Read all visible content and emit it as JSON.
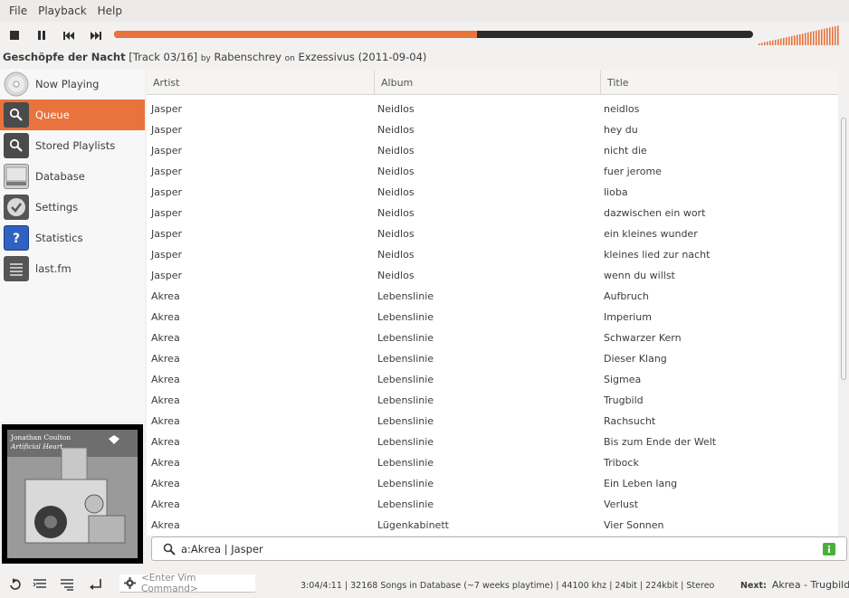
{
  "menubar": {
    "items": [
      "File",
      "Playback",
      "Help"
    ]
  },
  "toolbar": {
    "stop_icon": "stop-icon",
    "pause_icon": "pause-icon",
    "prev_icon": "previous-icon",
    "next_icon": "next-icon",
    "progress_fraction": 0.568,
    "accent": "#e8733c"
  },
  "now_playing": {
    "title": "Geschöpfe der Nacht",
    "track": "[Track 03/16]",
    "by": "by",
    "artist": "Rabenschrey",
    "on": "on",
    "album": "Exzessivus (2011-09-04)"
  },
  "sidebar": {
    "items": [
      {
        "label": "Now Playing",
        "icon": "cd-icon"
      },
      {
        "label": "Queue",
        "icon": "search-icon",
        "active": true
      },
      {
        "label": "Stored Playlists",
        "icon": "search-icon"
      },
      {
        "label": "Database",
        "icon": "drive-icon"
      },
      {
        "label": "Settings",
        "icon": "check-icon"
      },
      {
        "label": "Statistics",
        "icon": "help-icon"
      },
      {
        "label": "last.fm",
        "icon": "list-icon"
      }
    ]
  },
  "album_art": {
    "line1": "Jonathan Coulton",
    "line2": "Artificial Heart"
  },
  "table": {
    "headers": [
      "Artist",
      "Album",
      "Title"
    ],
    "rows": [
      [
        "Jasper",
        "Neidlos",
        "neidlos"
      ],
      [
        "Jasper",
        "Neidlos",
        "hey du"
      ],
      [
        "Jasper",
        "Neidlos",
        "nicht die"
      ],
      [
        "Jasper",
        "Neidlos",
        "fuer jerome"
      ],
      [
        "Jasper",
        "Neidlos",
        "lioba"
      ],
      [
        "Jasper",
        "Neidlos",
        "dazwischen ein wort"
      ],
      [
        "Jasper",
        "Neidlos",
        "ein kleines wunder"
      ],
      [
        "Jasper",
        "Neidlos",
        "kleines lied zur nacht"
      ],
      [
        "Jasper",
        "Neidlos",
        "wenn du willst"
      ],
      [
        "Akrea",
        "Lebenslinie",
        "Aufbruch"
      ],
      [
        "Akrea",
        "Lebenslinie",
        "Imperium"
      ],
      [
        "Akrea",
        "Lebenslinie",
        "Schwarzer Kern"
      ],
      [
        "Akrea",
        "Lebenslinie",
        "Dieser Klang"
      ],
      [
        "Akrea",
        "Lebenslinie",
        "Sigmea"
      ],
      [
        "Akrea",
        "Lebenslinie",
        "Trugbild"
      ],
      [
        "Akrea",
        "Lebenslinie",
        "Rachsucht"
      ],
      [
        "Akrea",
        "Lebenslinie",
        "Bis zum Ende der Welt"
      ],
      [
        "Akrea",
        "Lebenslinie",
        "Tribock"
      ],
      [
        "Akrea",
        "Lebenslinie",
        "Ein Leben lang"
      ],
      [
        "Akrea",
        "Lebenslinie",
        "Verlust"
      ],
      [
        "Akrea",
        "Lügenkabinett",
        "Vier Sonnen"
      ]
    ]
  },
  "filter": {
    "value": "a:Akrea | Jasper"
  },
  "bottom": {
    "vim_placeholder": "<Enter Vim Command>",
    "status": "3:04/4:11 | 32168 Songs in Database (~7 weeks playtime) | 44100 khz | 24bit | 224kbit | Stereo",
    "next_label": "Next:",
    "next_value": "Akrea - Trugbild"
  }
}
